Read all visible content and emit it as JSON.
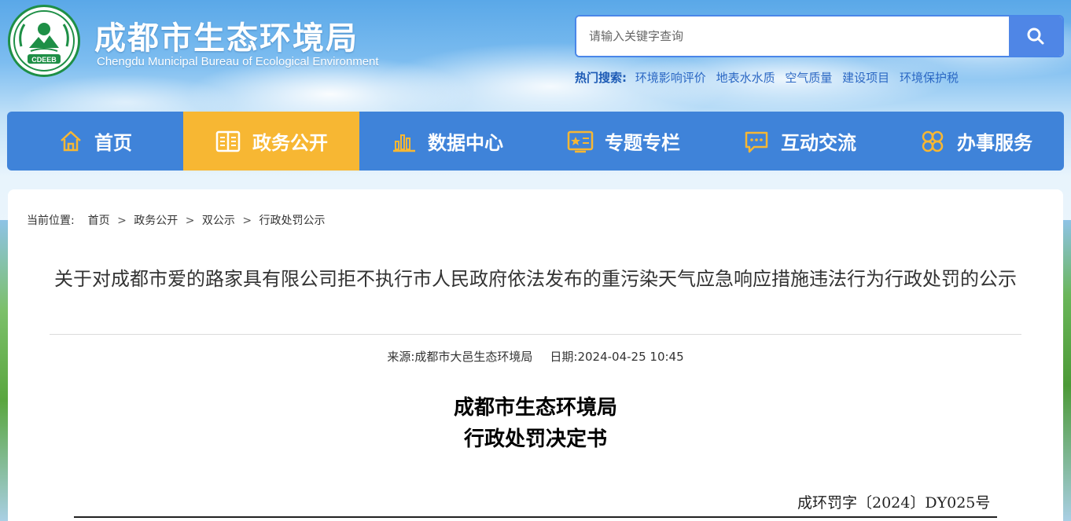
{
  "header": {
    "title": "成都市生态环境局",
    "subtitle": "Chengdu Municipal Bureau of Ecological Environment",
    "logo_text": "CDEEB"
  },
  "search": {
    "placeholder": "请输入关键字查询",
    "button_icon": "search-icon"
  },
  "hot_search": {
    "label": "热门搜索:",
    "links": [
      "环境影响评价",
      "地表水水质",
      "空气质量",
      "建设项目",
      "环境保护税"
    ]
  },
  "nav": {
    "items": [
      {
        "label": "首页",
        "icon": "home-icon"
      },
      {
        "label": "政务公开",
        "icon": "book-icon"
      },
      {
        "label": "数据中心",
        "icon": "bar-chart-icon"
      },
      {
        "label": "专题专栏",
        "icon": "star-card-icon"
      },
      {
        "label": "互动交流",
        "icon": "chat-bubble-icon"
      },
      {
        "label": "办事服务",
        "icon": "grid-circles-icon"
      }
    ],
    "active_index": 1,
    "colors": {
      "bar": "#3f83d9",
      "active": "#f7b733"
    }
  },
  "breadcrumb": {
    "prefix": "当前位置:",
    "items": [
      "首页",
      "政务公开",
      "双公示",
      "行政处罚公示"
    ],
    "separator": ">"
  },
  "article": {
    "title": "关于对成都市爱的路家具有限公司拒不执行市人民政府依法发布的重污染天气应急响应措施违法行为行政处罚的公示",
    "source": "来源:成都市大邑生态环境局",
    "date": "日期:2024-04-25 10:45",
    "doc_org": "成都市生态环境局",
    "doc_type": "行政处罚决定书",
    "doc_number": "成环罚字〔2024〕DY025号"
  }
}
